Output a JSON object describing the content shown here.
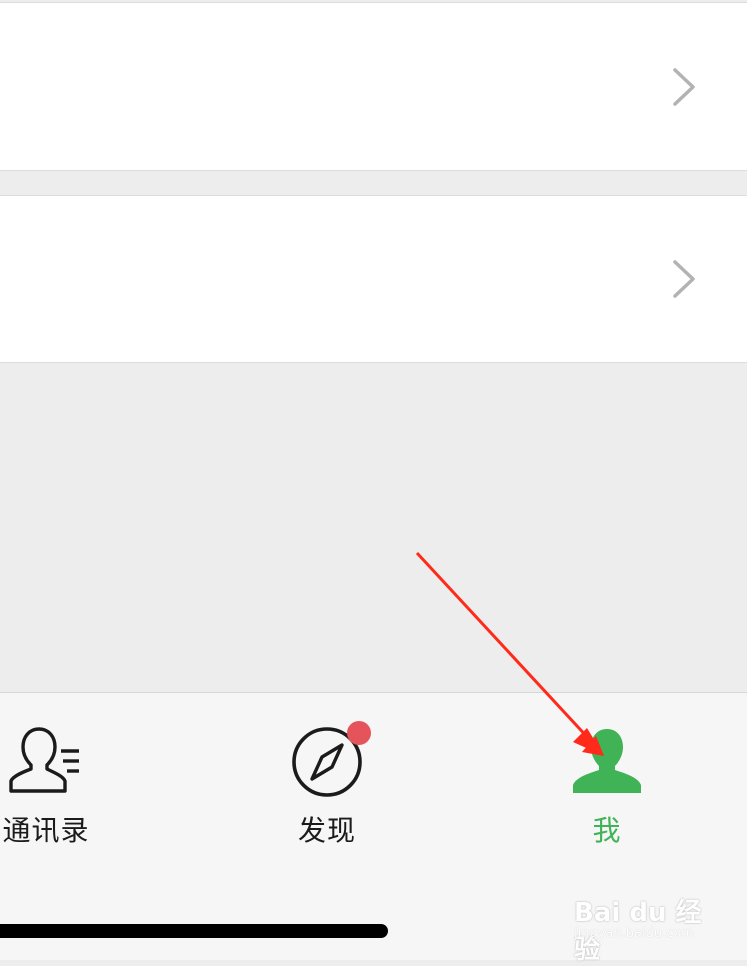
{
  "tabbar": {
    "tabs": [
      {
        "label": "通讯录",
        "icon": "contacts-icon",
        "active": false
      },
      {
        "label": "发现",
        "icon": "compass-icon",
        "active": false,
        "badge": true
      },
      {
        "label": "我",
        "icon": "person-icon",
        "active": true
      }
    ]
  },
  "watermark": {
    "brand": "Bai du 经验",
    "url": "jingyan.baidu.com"
  },
  "colors": {
    "active": "#3fb356",
    "badge": "#e5545a",
    "annotation_arrow": "#ff2a1a",
    "background": "#ededed"
  }
}
